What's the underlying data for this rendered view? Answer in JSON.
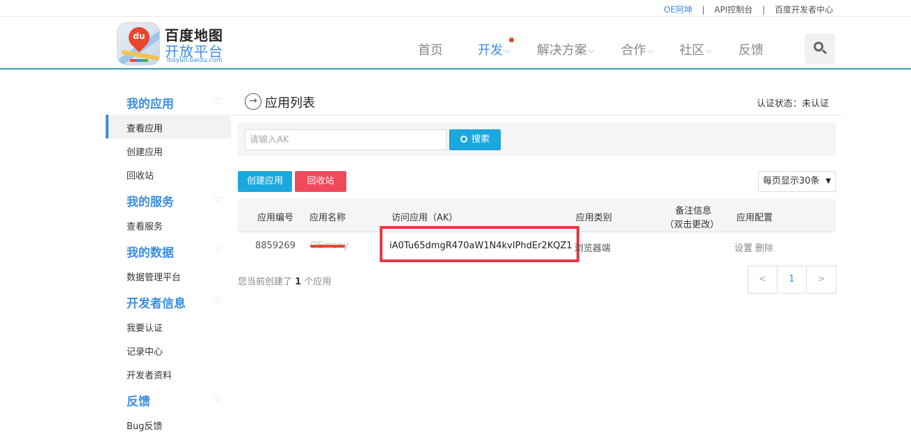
{
  "topbar": {
    "user": "OE阿坤",
    "console": "API控制台",
    "dev_center": "百度开发者中心"
  },
  "brand": {
    "name": "百度地图",
    "subtitle": "开放平台",
    "domain": "lbsyun.baidu.com",
    "logo_text": "du"
  },
  "nav": {
    "home": "首页",
    "develop": "开发",
    "solutions": "解决方案",
    "cooperation": "合作",
    "community": "社区",
    "feedback": "反馈"
  },
  "sidebar": {
    "my_apps": "我的应用",
    "view_apps": "查看应用",
    "create_app": "创建应用",
    "recycle_bin": "回收站",
    "my_services": "我的服务",
    "view_services": "查看服务",
    "my_data": "我的数据",
    "data_platform": "数据管理平台",
    "dev_info": "开发者信息",
    "certify": "我要认证",
    "records": "记录中心",
    "dev_profile": "开发者资料",
    "feedback": "反馈",
    "bug_feedback": "Bug反馈"
  },
  "main": {
    "title": "应用列表",
    "auth_status": "认证状态：未认证",
    "search_placeholder": "请输入AK",
    "search_button": "搜索",
    "create_button": "创建应用",
    "recycle_button": "回收站",
    "page_size": "每页显示30条",
    "table": {
      "headers": {
        "id": "应用编号",
        "name": "应用名称",
        "ak": "访问应用（AK）",
        "type": "应用类别",
        "note1": "备注信息",
        "note2": "（双击更改）",
        "config": "应用配置"
      },
      "row": {
        "id": "8859269",
        "name": "OEmeny",
        "ak": "iA0Tu65dmgR470aW1N4kvIPhdEr2KQZ1",
        "type": "浏览器端",
        "settings": "设置",
        "delete": "删除"
      }
    },
    "count_prefix": "您当前创建了",
    "count_value": "1",
    "count_suffix": "个应用",
    "pager": {
      "prev": "<",
      "page": "1",
      "next": ">"
    }
  },
  "colors": {
    "accent": "#3b8ee0",
    "button_blue": "#1ba8e0",
    "button_red": "#f0495b",
    "highlight": "#e63946"
  }
}
